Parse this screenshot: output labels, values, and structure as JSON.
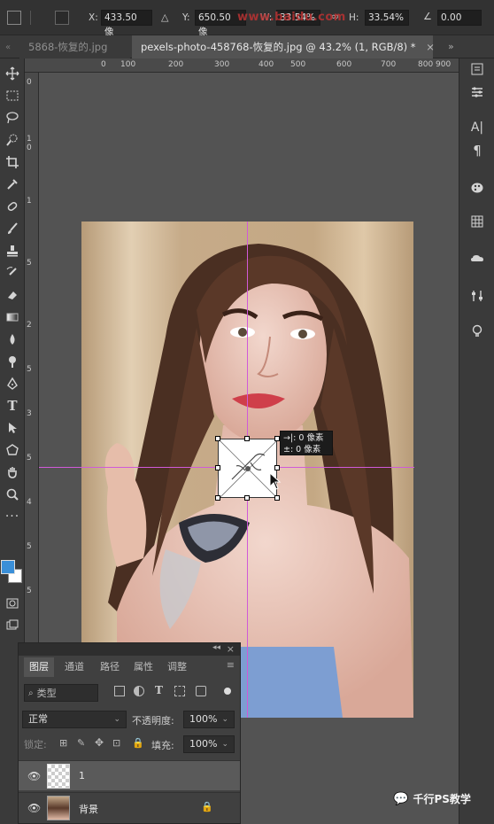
{
  "options_bar": {
    "x_label": "X:",
    "x_value": "433.50 像",
    "y_label": "Y:",
    "y_value": "650.50 像",
    "w_label": "W:",
    "w_value": "33.54%",
    "h_label": "H:",
    "h_value": "33.54%",
    "angle_value": "0.00",
    "watermark": "www.baidu.com"
  },
  "tabs": [
    {
      "label": "5868-恢复的.jpg"
    },
    {
      "label": "pexels-photo-458768-恢复的.jpg @ 43.2% (1, RGB/8) *"
    }
  ],
  "ruler_top_labels": [
    "0",
    "100",
    "200",
    "300",
    "400",
    "500",
    "600",
    "700",
    "800",
    "900"
  ],
  "ruler_left_labels": [
    "0",
    "1",
    "0",
    "1",
    "5",
    "2",
    "5",
    "3",
    "5",
    "4",
    "5",
    "5"
  ],
  "tooltip": {
    "line1": "→|: 0 像素",
    "line2": "±: 0 像素"
  },
  "layers_panel": {
    "tabs": [
      "图层",
      "通道",
      "路径",
      "属性",
      "调整"
    ],
    "filter_label": "类型",
    "blend_mode": "正常",
    "opacity_label": "不透明度:",
    "opacity_value": "100%",
    "lock_label": "锁定:",
    "fill_label": "填充:",
    "fill_value": "100%",
    "layers": [
      {
        "name": "1",
        "selected": true
      },
      {
        "name": "背景",
        "selected": false,
        "locked": true
      }
    ]
  },
  "brand": {
    "label": "千行PS教学"
  },
  "colors": {
    "foreground": "#3a8fd8",
    "background": "#ffffff",
    "guide": "#d05ad8"
  }
}
